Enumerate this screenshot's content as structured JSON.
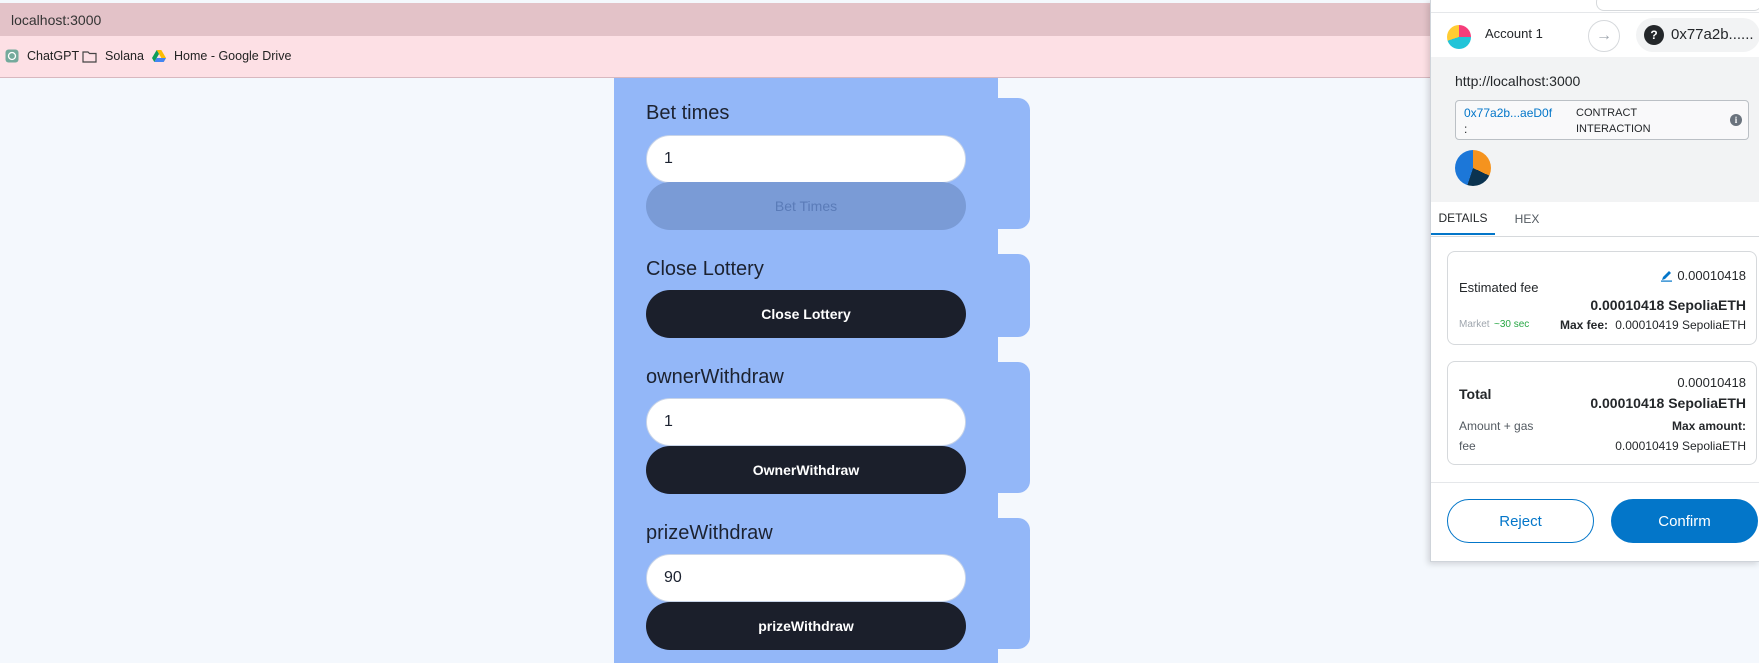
{
  "browser": {
    "url": "localhost:3000",
    "bookmarks": [
      "ChatGPT",
      "Solana",
      "Home - Google Drive"
    ]
  },
  "sections": [
    {
      "title": "Bet times",
      "input_value": "1",
      "button_label": "Bet Times",
      "button_disabled": true
    },
    {
      "title": "Close Lottery",
      "button_label": "Close Lottery"
    },
    {
      "title": "ownerWithdraw",
      "input_value": "1",
      "button_label": "OwnerWithdraw"
    },
    {
      "title": "prizeWithdraw",
      "input_value": "90",
      "button_label": "prizeWithdraw"
    }
  ],
  "wallet": {
    "account_name": "Account 1",
    "account_address": "0x77a2b......",
    "origin": "http://localhost:3000",
    "contract_address": "0x77a2b...aeD0f",
    "contract_colon": ":",
    "contract_label": "CONTRACT INTERACTION",
    "tabs": [
      "DETAILS",
      "HEX"
    ],
    "fee": {
      "label": "Estimated fee",
      "value": "0.00010418",
      "value_bold": "0.00010418 SepoliaETH",
      "market_label": "Market",
      "market_time": "~30 sec",
      "max_fee_label": "Max fee:",
      "max_fee_value": "0.00010419 SepoliaETH"
    },
    "total": {
      "label": "Total",
      "value": "0.00010418",
      "value_bold": "0.00010418 SepoliaETH",
      "sub_label_1": "Amount + gas",
      "sub_label_2": "fee",
      "max_amount_label": "Max amount:",
      "max_amount_value": "0.00010419 SepoliaETH"
    },
    "buttons": {
      "reject": "Reject",
      "confirm": "Confirm"
    },
    "colors": {
      "primary": "#0376c9",
      "market_green": "#28a745"
    }
  }
}
